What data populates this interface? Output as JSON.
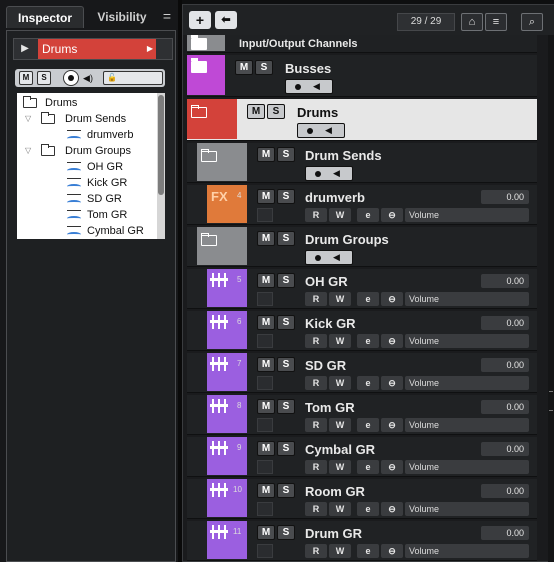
{
  "colors": {
    "drums_red": "#d3423a",
    "busses_magenta": "#bf49d6",
    "folder_gray": "#8a8c8f",
    "fx_orange": "#e07a3a",
    "group_purple": "#9b5fe0",
    "selected_bg": "#e6e6e6"
  },
  "inspector": {
    "tab_inspector": "Inspector",
    "tab_visibility": "Visibility",
    "menu_icon": "=",
    "header_play": "▶",
    "track_name": "Drums",
    "header_arrow": "▶",
    "mute": "M",
    "solo": "S",
    "tree": [
      {
        "label": "Drums",
        "type": "folder"
      },
      {
        "label": "Drum Sends",
        "type": "folder"
      },
      {
        "label": "drumverb",
        "type": "track"
      },
      {
        "label": "Drum Groups",
        "type": "folder"
      },
      {
        "label": "OH GR",
        "type": "track"
      },
      {
        "label": "Kick GR",
        "type": "track"
      },
      {
        "label": "SD GR",
        "type": "track"
      },
      {
        "label": "Tom GR",
        "type": "track"
      },
      {
        "label": "Cymbal GR",
        "type": "track"
      }
    ]
  },
  "toolbar": {
    "add": "+",
    "add_special": "⬅",
    "track_count": "29 / 29",
    "search": "⌕"
  },
  "tracks": [
    {
      "name": "Input/Output Channels",
      "kind": "io"
    },
    {
      "name": "Busses",
      "kind": "folder",
      "color": "busses_magenta"
    },
    {
      "name": "Drums",
      "kind": "folder",
      "color": "drums_red",
      "selected": true
    },
    {
      "name": "Drum Sends",
      "kind": "subfolder"
    },
    {
      "name": "drumverb",
      "kind": "fx",
      "number": "4",
      "value": "0.00",
      "volume": "Volume",
      "fx_label": "FX"
    },
    {
      "name": "Drum Groups",
      "kind": "subfolder"
    },
    {
      "name": "OH GR",
      "kind": "group",
      "number": "5",
      "value": "0.00",
      "volume": "Volume"
    },
    {
      "name": "Kick GR",
      "kind": "group",
      "number": "6",
      "value": "0.00",
      "volume": "Volume"
    },
    {
      "name": "SD GR",
      "kind": "group",
      "number": "7",
      "value": "0.00",
      "volume": "Volume"
    },
    {
      "name": "Tom GR",
      "kind": "group",
      "number": "8",
      "value": "0.00",
      "volume": "Volume"
    },
    {
      "name": "Cymbal GR",
      "kind": "group",
      "number": "9",
      "value": "0.00",
      "volume": "Volume"
    },
    {
      "name": "Room GR",
      "kind": "group",
      "number": "10",
      "value": "0.00",
      "volume": "Volume"
    },
    {
      "name": "Drum GR",
      "kind": "group",
      "number": "11",
      "value": "0.00",
      "volume": "Volume"
    }
  ],
  "controls": {
    "mute": "M",
    "solo": "S",
    "read": "R",
    "write": "W",
    "edit": "e",
    "link": "⊖"
  }
}
